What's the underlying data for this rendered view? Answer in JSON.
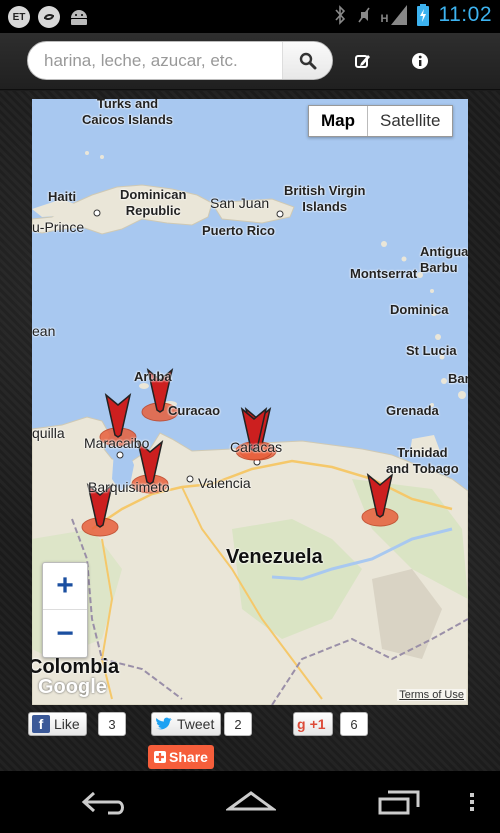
{
  "status_bar": {
    "time": "11:02",
    "left_icons": [
      "et-icon",
      "sync-icon",
      "android-icon"
    ],
    "right_icons": [
      "bluetooth-icon",
      "mute-icon",
      "signal-h-icon",
      "battery-charging-icon"
    ],
    "et_label": "ET",
    "signal_label": "H"
  },
  "toolbar": {
    "search_placeholder": "harina, leche, azucar, etc.",
    "search_icon": "search-icon",
    "edit_icon": "edit-icon",
    "info_icon": "info-icon"
  },
  "map": {
    "type_controls": [
      "Map",
      "Satellite"
    ],
    "active_type": "Map",
    "zoom_in": "+",
    "zoom_out": "−",
    "labels": {
      "turks": "Turks and\nCaicos Islands",
      "haiti": "Haiti",
      "dominican": "Dominican\nRepublic",
      "san_juan": "San Juan",
      "puerto_rico": "Puerto Rico",
      "bvi": "British Virgin\nIslands",
      "antigua": "Antigua\nBarbu",
      "montserrat": "Montserrat",
      "dominica": "Dominica",
      "st_lucia": "St Lucia",
      "barb": "Bar",
      "grenada": "Grenada",
      "trinidad": "Trinidad\nand Tobago",
      "prince": "u-Prince",
      "ean": "ean",
      "aruba": "Aruba",
      "curacao": "Curacao",
      "maracaibo": "Maracaibo",
      "quilla": "quilla",
      "caracas": "Caracas",
      "barquisimeto": "Barquisimeto",
      "valencia": "Valencia",
      "venezuela": "Venezuela",
      "colombia": "Colombia"
    },
    "google_logo": "Google",
    "terms": "Terms of Use",
    "marker_count": 7
  },
  "social": {
    "like_label": "Like",
    "like_count": "3",
    "tweet_label": "Tweet",
    "tweet_count": "2",
    "gplus_label": "+1",
    "gplus_count": "6",
    "share_label": "Share"
  },
  "nav_bar": {
    "icons": [
      "back-icon",
      "home-icon",
      "recents-icon",
      "menu-icon"
    ]
  },
  "colors": {
    "status_time": "#3db3f0",
    "water": "#a8c8f0",
    "land": "#eae6d8",
    "marker": "#cc1f1f",
    "share": "#f65e3b",
    "facebook": "#3b5998",
    "twitter": "#1da1f2",
    "gplus": "#dd4b39"
  }
}
